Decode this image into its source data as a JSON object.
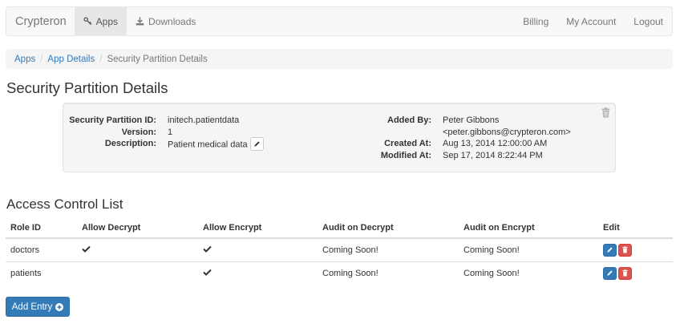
{
  "navbar": {
    "brand": "Crypteron",
    "links": [
      {
        "label": "Apps",
        "icon": "key-icon",
        "active": true
      },
      {
        "label": "Downloads",
        "icon": "download-icon",
        "active": false
      }
    ],
    "right_links": [
      "Billing",
      "My Account",
      "Logout"
    ]
  },
  "breadcrumb": {
    "items": [
      "Apps",
      "App Details"
    ],
    "separator": "/",
    "active": "Security Partition Details"
  },
  "page_title": "Security Partition Details",
  "details": {
    "left": [
      {
        "label": "Security Partition ID:",
        "value": "initech.patientdata"
      },
      {
        "label": "Version:",
        "value": "1"
      },
      {
        "label": "Description:",
        "value": "Patient medical data"
      }
    ],
    "right": [
      {
        "label": "Added By:",
        "value": "Peter Gibbons"
      },
      {
        "label": "",
        "value": "<peter.gibbons@crypteron.com>"
      },
      {
        "label": "Created At:",
        "value": "Aug 13, 2014 12:00:00 AM"
      },
      {
        "label": "Modified At:",
        "value": "Sep 17, 2014 8:22:44 PM"
      }
    ]
  },
  "acl": {
    "title": "Access Control List",
    "headers": [
      "Role ID",
      "Allow Decrypt",
      "Allow Encrypt",
      "Audit on Decrypt",
      "Audit on Encrypt",
      "Edit"
    ],
    "rows": [
      {
        "role": "doctors",
        "allow_decrypt": true,
        "allow_encrypt": true,
        "audit_decrypt": "Coming Soon!",
        "audit_encrypt": "Coming Soon!"
      },
      {
        "role": "patients",
        "allow_decrypt": false,
        "allow_encrypt": true,
        "audit_decrypt": "Coming Soon!",
        "audit_encrypt": "Coming Soon!"
      }
    ]
  },
  "add_button": {
    "label": "Add Entry",
    "icon": "plus-circle-icon"
  },
  "colors": {
    "primary": "#337ab7",
    "danger": "#d9534f",
    "link": "#337ab7"
  }
}
